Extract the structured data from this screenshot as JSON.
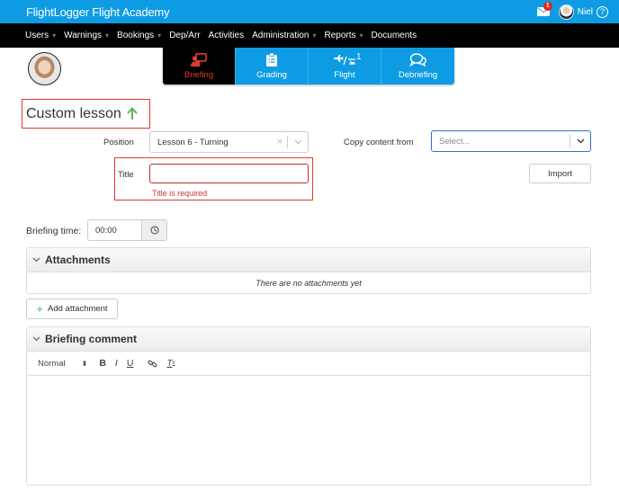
{
  "header": {
    "app_title": "FlightLogger Flight Academy",
    "mail_badge": "1",
    "user_name": "Niel",
    "help_label": "?"
  },
  "nav": {
    "items": [
      {
        "label": "Users",
        "dropdown": true
      },
      {
        "label": "Warnings",
        "dropdown": true
      },
      {
        "label": "Bookings",
        "dropdown": true
      },
      {
        "label": "Dep/Arr",
        "dropdown": false
      },
      {
        "label": "Activities",
        "dropdown": false
      },
      {
        "label": "Administration",
        "dropdown": true
      },
      {
        "label": "Reports",
        "dropdown": true
      },
      {
        "label": "Documents",
        "dropdown": false
      }
    ],
    "caret": "⌄"
  },
  "steps": [
    {
      "label": "Briefing",
      "icon": "presentation-icon",
      "active": true
    },
    {
      "label": "Grading",
      "icon": "clipboard-icon",
      "active": false
    },
    {
      "label": "Flight",
      "icon": "flight-icon",
      "active": false,
      "count": "1"
    },
    {
      "label": "Debriefing",
      "icon": "chat-bubbles-icon",
      "active": false
    }
  ],
  "lesson": {
    "title": "Custom lesson",
    "position_label": "Position",
    "position_value": "Lesson 6 - Turning",
    "copy_label": "Copy content from",
    "copy_placeholder": "Select...",
    "title_label": "Title",
    "title_value": "",
    "title_error": "Title is required",
    "import_label": "Import",
    "briefing_time_label": "Briefing time:",
    "briefing_time_value": "00:00"
  },
  "attachments": {
    "title": "Attachments",
    "empty_text": "There are no attachments yet",
    "add_label": "Add attachment"
  },
  "briefing_comment": {
    "title": "Briefing comment",
    "format_value": "Normal",
    "toolbar": [
      "bold",
      "italic",
      "underline",
      "link",
      "clear-format"
    ],
    "content": ""
  },
  "colors": {
    "brand_blue": "#0d9ce3",
    "nav_black": "#000000",
    "active_red": "#e03b2c",
    "error_red": "#c8382c",
    "success_green": "#5cb85c",
    "focus_blue": "#2c6fd1"
  }
}
